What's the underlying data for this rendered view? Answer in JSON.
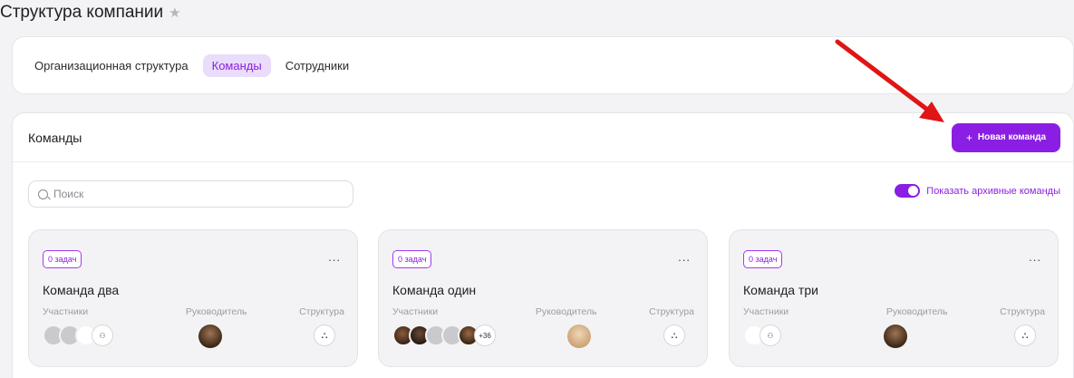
{
  "page": {
    "title": "Структура компании",
    "star_icon": "star-icon"
  },
  "tabs": [
    {
      "label": "Организационная структура",
      "active": false
    },
    {
      "label": "Команды",
      "active": true
    },
    {
      "label": "Сотрудники",
      "active": false
    }
  ],
  "teams": {
    "title": "Команды",
    "new_team_label": "Новая команда",
    "search_placeholder": "Поиск",
    "archive_toggle_label": "Показать архивные команды",
    "archive_toggle_on": true
  },
  "columns": {
    "members": "Участники",
    "leader": "Руководитель",
    "structure": "Структура"
  },
  "cards": [
    {
      "badge": "0 задач",
      "title": "Команда два",
      "menu": "..."
    },
    {
      "badge": "0 задач",
      "title": "Команда один",
      "menu": "...",
      "extra_members": "+36"
    },
    {
      "badge": "0 задач",
      "title": "Команда три",
      "menu": "..."
    }
  ],
  "colors": {
    "accent": "#8a1fe3",
    "accent_light": "#eadcfb",
    "annotation_arrow": "#e01515"
  }
}
